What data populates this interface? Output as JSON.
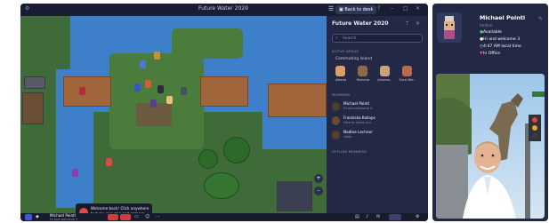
{
  "app": {
    "title": "Future Water 2020",
    "back_to_desk_label": "Back to desk",
    "title_dropdown_icon": "chevron-down-icon"
  },
  "sidebar": {
    "title": "Future Water 2020",
    "search_placeholder": "Search",
    "active_areas_header": "ACTIVE AREAS",
    "active_group": "Commuting Island",
    "active_people": [
      {
        "name": "Alberto"
      },
      {
        "name": "Rheimes"
      },
      {
        "name": "Johanna..."
      },
      {
        "name": "Excel Ber..."
      }
    ],
    "members_header": "MEMBERS",
    "members": [
      {
        "name": "Michael Pointl",
        "status": "Hi and welcome 3"
      },
      {
        "name": "Franziska Kallops",
        "status": "Nice to meet you"
      },
      {
        "name": "Nadine Lechner",
        "status": "Hello"
      }
    ],
    "offline_header": "OFFLINE MEMBERS"
  },
  "toast": {
    "message": "Welcome back! Click anywhere to turn your mic and camera back on."
  },
  "bottombar": {
    "user_name": "Michael Pointl",
    "user_status": "Hi and welcome 3"
  },
  "profile": {
    "name": "Michael Pointl",
    "handle": "he/him",
    "status_available": "Available",
    "status_message": "Hi and welcome 3",
    "local_time": "4:47 AM local time",
    "location": "In Office"
  },
  "colors": {
    "app_bg": "#202540",
    "accent": "#3a5bd9",
    "available": "#3ecf6e",
    "record": "#e04646"
  }
}
